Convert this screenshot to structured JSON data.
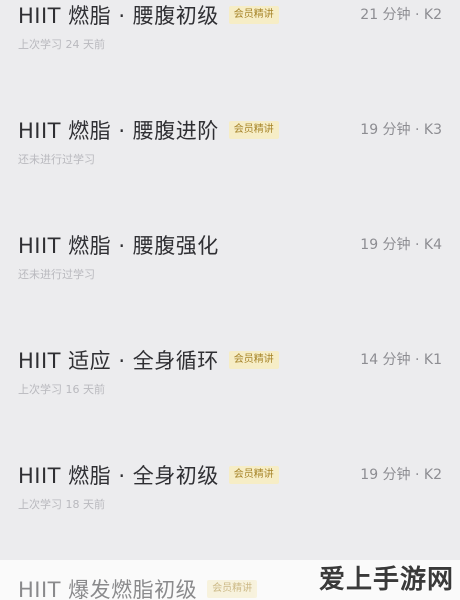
{
  "courses": [
    {
      "title": "HIIT 燃脂 · 腰腹初级",
      "badge": "会员精讲",
      "meta": "21 分钟 · K2",
      "sub": "上次学习 24 天前"
    },
    {
      "title": "HIIT 燃脂 · 腰腹进阶",
      "badge": "会员精讲",
      "meta": "19 分钟 · K3",
      "sub": "还未进行过学习"
    },
    {
      "title": "HIIT 燃脂 · 腰腹强化",
      "badge": "",
      "meta": "19 分钟 · K4",
      "sub": "还未进行过学习"
    },
    {
      "title": "HIIT 适应 · 全身循环",
      "badge": "会员精讲",
      "meta": "14 分钟 · K1",
      "sub": "上次学习 16 天前"
    },
    {
      "title": "HIIT 燃脂 · 全身初级",
      "badge": "会员精讲",
      "meta": "19 分钟 · K2",
      "sub": "上次学习 18 天前"
    }
  ],
  "partial_course": {
    "title": "HIIT 爆发燃脂初级",
    "badge": "会员精讲"
  },
  "watermark": "爱上手游网"
}
